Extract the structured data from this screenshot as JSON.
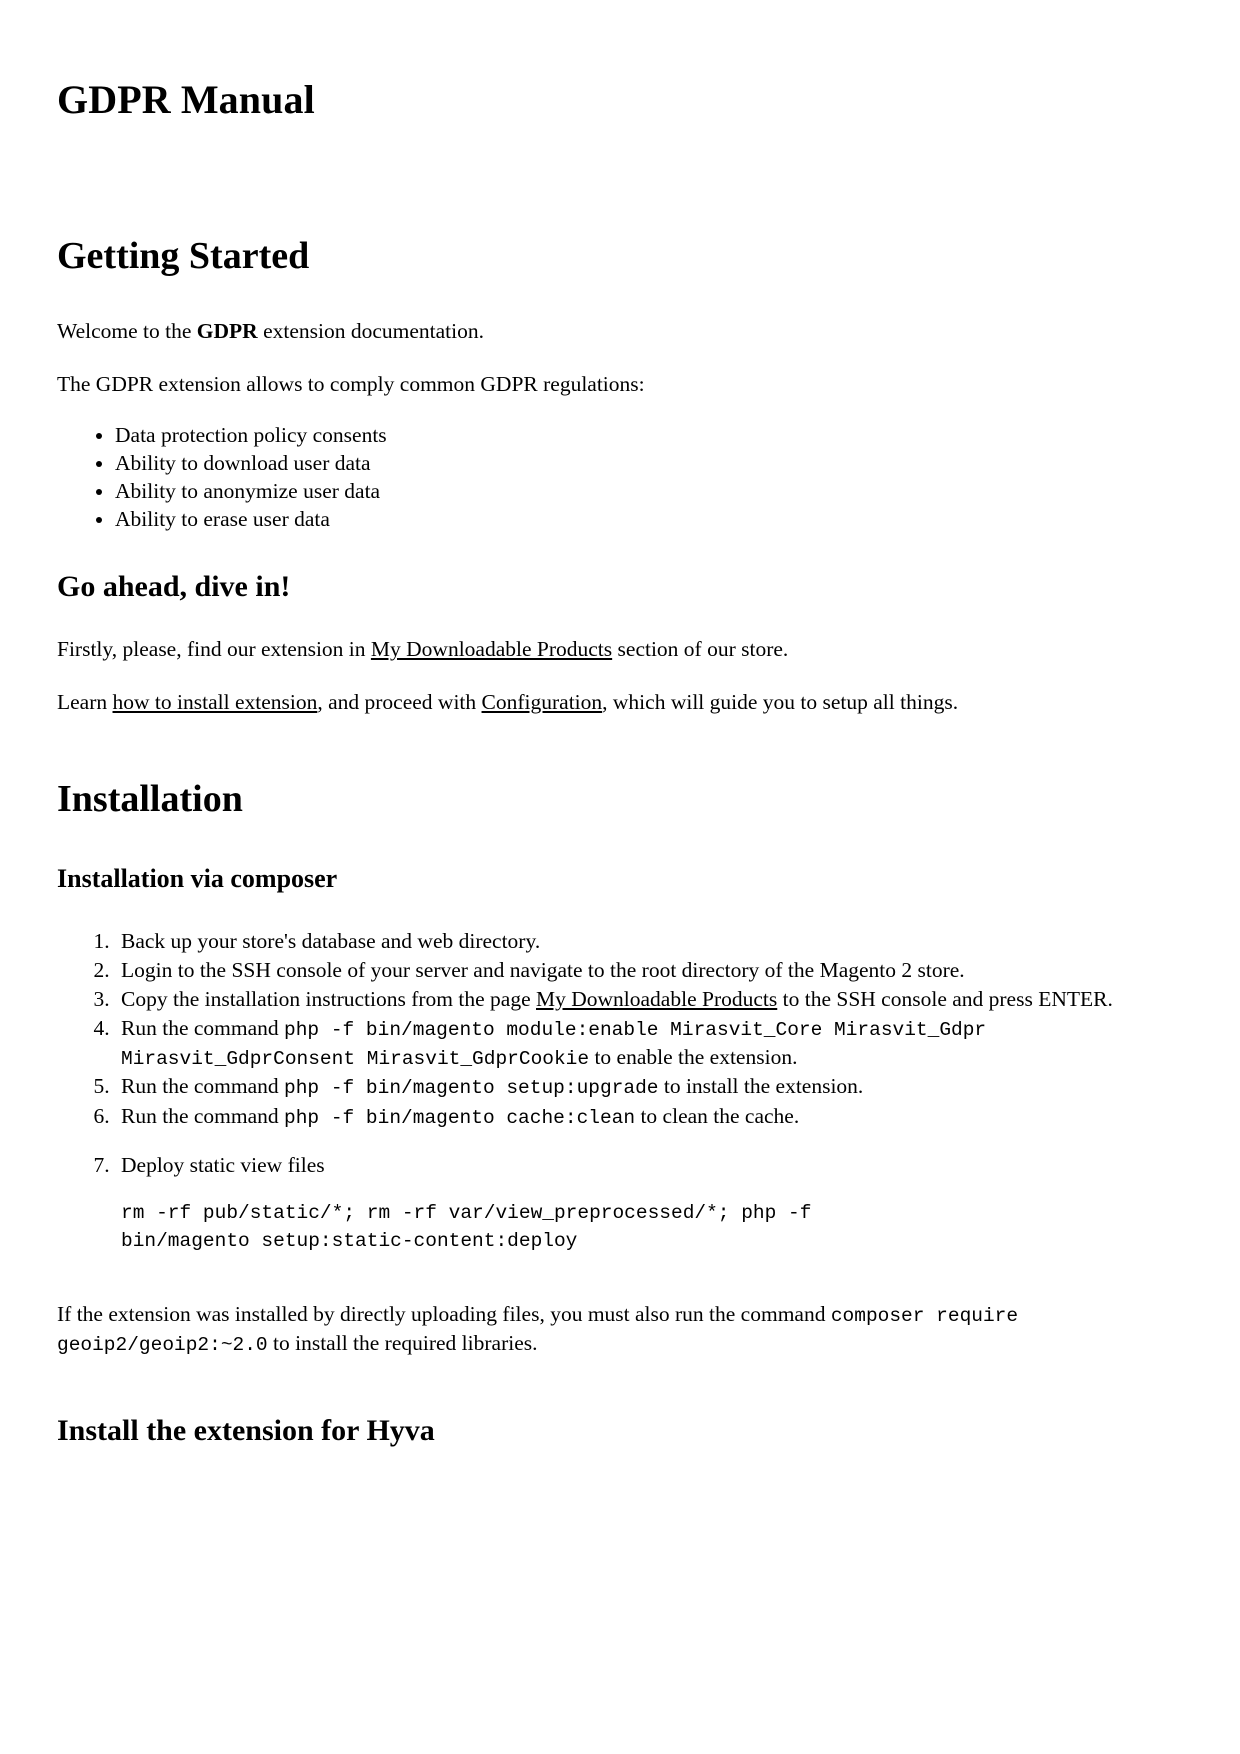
{
  "document": {
    "title": "GDPR Manual"
  },
  "getting_started": {
    "heading": "Getting Started",
    "welcome_prefix": "Welcome to the ",
    "welcome_bold": "GDPR",
    "welcome_suffix": " extension documentation.",
    "intro": "The GDPR extension allows to comply common GDPR regulations:",
    "features": [
      "Data protection policy consents",
      "Ability to download user data",
      "Ability to anonymize user data",
      "Ability to erase user data"
    ],
    "dive_in_heading": "Go ahead, dive in!",
    "firstly_prefix": "Firstly, please, find our extension in ",
    "firstly_link": "My Downloadable Products",
    "firstly_suffix": " section of our store.",
    "learn_prefix": "Learn ",
    "learn_link_1": "how to install extension",
    "learn_middle": ", and proceed with ",
    "learn_link_2": "Configuration",
    "learn_suffix": ", which will guide you to setup all things."
  },
  "installation": {
    "heading": "Installation",
    "composer_heading": "Installation via composer",
    "steps": {
      "step1": "Back up your store's database and web directory.",
      "step2": "Login to the SSH console of your server and navigate to the root directory of the Magento 2 store.",
      "step3_prefix": "Copy the installation instructions from the page ",
      "step3_link": "My Downloadable Products",
      "step3_suffix": " to the SSH console and press ENTER.",
      "step4_prefix": "Run the command ",
      "step4_code": "php -f bin/magento module:enable Mirasvit_Core Mirasvit_Gdpr Mirasvit_GdprConsent Mirasvit_GdprCookie",
      "step4_suffix": " to enable the extension.",
      "step5_prefix": "Run the command ",
      "step5_code": "php -f bin/magento setup:upgrade",
      "step5_suffix": " to install the extension.",
      "step6_prefix": "Run the command ",
      "step6_code": "php -f bin/magento cache:clean",
      "step6_suffix": " to clean the cache.",
      "step7_label": "Deploy static view files",
      "step7_code": "rm -rf pub/static/*; rm -rf var/view_preprocessed/*; php -f bin/magento setup:static-content:deploy"
    },
    "geoip_prefix": "If the extension was installed by directly uploading files, you must also run the command ",
    "geoip_code": "composer require geoip2/geoip2:~2.0",
    "geoip_suffix": " to install the required libraries.",
    "hyva_heading": "Install the extension for Hyva"
  }
}
